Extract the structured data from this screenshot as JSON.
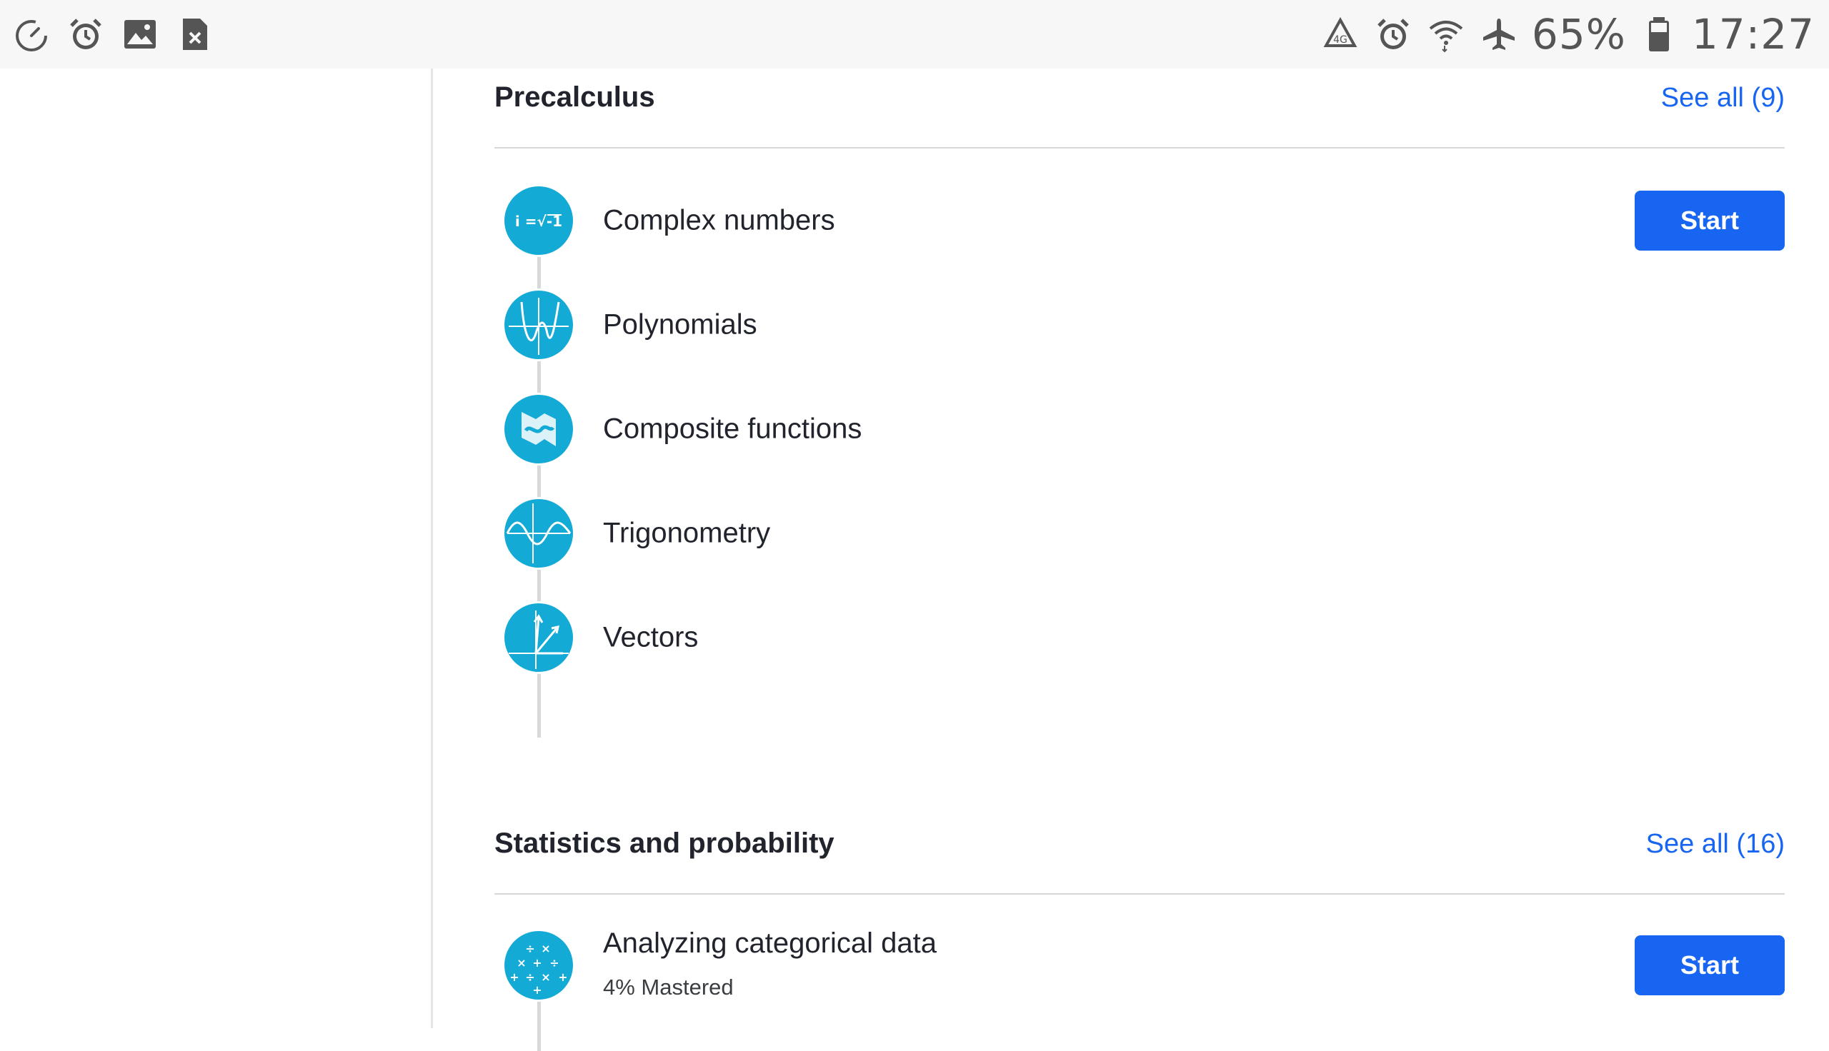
{
  "status_bar": {
    "left_icons": [
      "speedometer-icon",
      "alarm-icon",
      "image-icon",
      "close-box-icon"
    ],
    "right_icons": [
      "recycle-icon",
      "alarm-icon",
      "wifi-icon",
      "airplane-icon"
    ],
    "battery_percent": "65%",
    "time": "17:27"
  },
  "sections": [
    {
      "title": "Precalculus",
      "see_all": "See all (9)",
      "units": [
        {
          "label": "Complex numbers",
          "icon": "complex-numbers-icon",
          "button": "Start"
        },
        {
          "label": "Polynomials",
          "icon": "polynomials-icon"
        },
        {
          "label": "Composite functions",
          "icon": "composite-functions-icon"
        },
        {
          "label": "Trigonometry",
          "icon": "trigonometry-icon"
        },
        {
          "label": "Vectors",
          "icon": "vectors-icon"
        }
      ]
    },
    {
      "title": "Statistics and probability",
      "see_all": "See all (16)",
      "units": [
        {
          "label": "Analyzing categorical data",
          "icon": "categorical-data-icon",
          "sub": "4% Mastered",
          "button": "Start"
        }
      ]
    }
  ],
  "colors": {
    "accent": "#1865f2",
    "icon_bg": "#14aad6",
    "status_bar_bg": "#f7f7f7"
  }
}
